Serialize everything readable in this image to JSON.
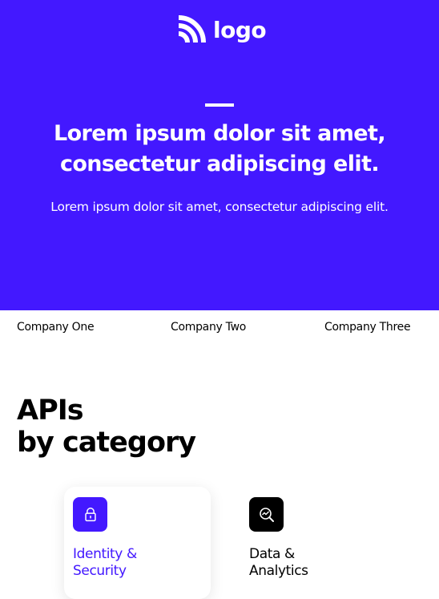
{
  "header": {
    "logo_text": "logo",
    "logo_icon": "signal-arcs-icon",
    "title_line1": "Lorem ipsum dolor sit amet,",
    "title_line2": "consectetur adipiscing elit.",
    "subtitle": "Lorem ipsum dolor sit amet, consectetur adipiscing elit."
  },
  "companies": [
    "Company One",
    "Company Two",
    "Company Three"
  ],
  "apis": {
    "title_line1": "APIs",
    "title_line2": "by category",
    "categories": [
      {
        "label_line1": "Identity &",
        "label_line2": "Security",
        "icon": "lock-icon",
        "color": "#4318ff"
      },
      {
        "label_line1": "Data &",
        "label_line2": "Analytics",
        "icon": "analytics-icon",
        "color": "#000000"
      }
    ]
  },
  "colors": {
    "brand": "#4318ff",
    "text": "#000000",
    "background": "#ffffff"
  }
}
